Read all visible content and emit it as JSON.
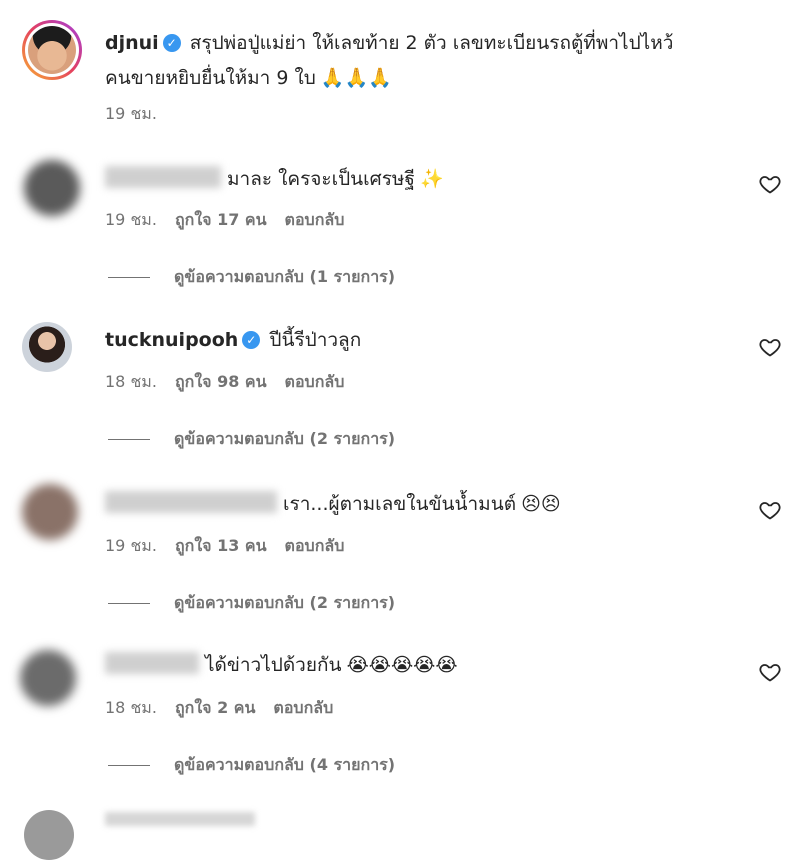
{
  "caption": {
    "username": "djnui",
    "line1": "สรุปพ่อปู่แม่ย่า ให้เลขท้าย 2 ตัว เลขทะเบียนรถตู้ที่พาไปไหว้",
    "line2": "คนขายหยิบยื่นให้มา 9 ใบ",
    "line2_emoji": "🙏🙏🙏",
    "time": "19 ชม."
  },
  "comments": [
    {
      "username": "",
      "text": "มาละ ใครจะเป็นเศรษฐี",
      "emoji": "✨",
      "time": "19 ชม.",
      "likes": "ถูกใจ 17 คน",
      "reply": "ตอบกลับ",
      "view_replies": "ดูข้อความตอบกลับ (1 รายการ)"
    },
    {
      "username": "tucknuipooh",
      "text": "ปีนี้รีป่าวลูก",
      "emoji": "",
      "time": "18 ชม.",
      "likes": "ถูกใจ 98 คน",
      "reply": "ตอบกลับ",
      "view_replies": "ดูข้อความตอบกลับ (2 รายการ)"
    },
    {
      "username": "",
      "text": "เรา...ผู้ตามเลขในขันน้ำมนต์",
      "emoji": "😣😣",
      "time": "19 ชม.",
      "likes": "ถูกใจ 13 คน",
      "reply": "ตอบกลับ",
      "view_replies": "ดูข้อความตอบกลับ (2 รายการ)"
    },
    {
      "username": "",
      "text": "ได้ข่าวไปด้วยกัน",
      "emoji": "😭😭😭😭😭",
      "time": "18 ชม.",
      "likes": "ถูกใจ 2 คน",
      "reply": "ตอบกลับ",
      "view_replies": "ดูข้อความตอบกลับ (4 รายการ)"
    }
  ],
  "icons": {
    "heart": "heart-icon",
    "verified": "verified-badge-icon"
  },
  "colors": {
    "text": "#262626",
    "secondary": "#737373",
    "verified": "#3897f0",
    "background": "#ffffff"
  }
}
